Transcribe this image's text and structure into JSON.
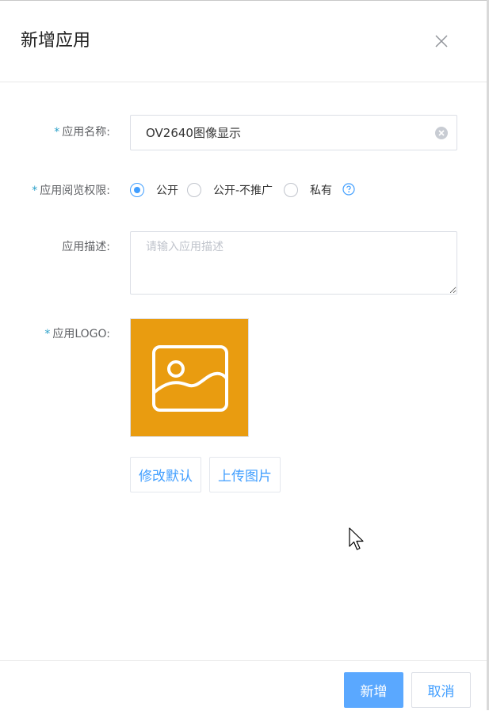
{
  "dialog": {
    "title": "新增应用",
    "close_icon": "close-icon"
  },
  "form": {
    "name": {
      "required_mark": "*",
      "label": "应用名称:",
      "value": "OV2640图像显示",
      "clear_icon": "clear-icon"
    },
    "permission": {
      "required_mark": "*",
      "label": "应用阅览权限:",
      "options": [
        {
          "label": "公开",
          "checked": true
        },
        {
          "label": "公开-不推广",
          "checked": false
        },
        {
          "label": "私有",
          "checked": false
        }
      ],
      "help_icon": "question-circle-icon"
    },
    "description": {
      "label": "应用描述:",
      "placeholder": "请输入应用描述"
    },
    "logo": {
      "required_mark": "*",
      "label": "应用LOGO:",
      "icon": "image-placeholder-icon",
      "background_color": "#e99c10",
      "modify_default_label": "修改默认",
      "upload_label": "上传图片"
    }
  },
  "footer": {
    "confirm_label": "新增",
    "cancel_label": "取消"
  },
  "colors": {
    "primary": "#409eff",
    "primary_button": "#5aa8ff",
    "required": "#2aa0c8"
  }
}
